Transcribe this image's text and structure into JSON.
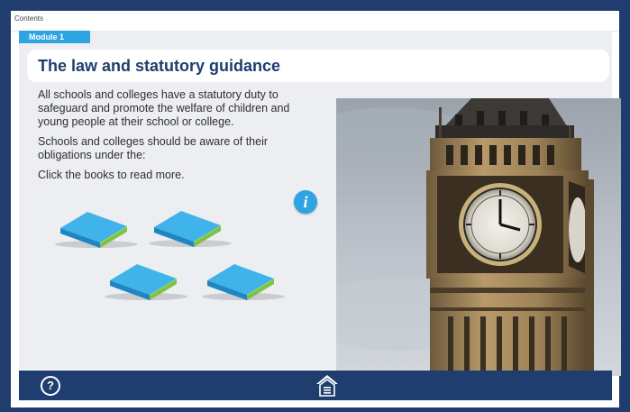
{
  "topbar": {
    "contents_label": "Contents"
  },
  "module": {
    "tab_label": "Module 1"
  },
  "page": {
    "title": "The law and statutory guidance",
    "paragraphs": [
      "All schools and colleges have a statutory duty to safeguard and promote the welfare of children and young people at their school or college.",
      "Schools and colleges should be aware of their obligations under the:",
      "Click the books to read more."
    ]
  },
  "info": {
    "icon": "info-icon",
    "glyph": "i"
  },
  "books": [
    {
      "icon": "book-icon"
    },
    {
      "icon": "book-icon"
    },
    {
      "icon": "book-icon"
    },
    {
      "icon": "book-icon"
    }
  ],
  "image": {
    "subject": "big-ben-clock-tower"
  },
  "footer": {
    "help_glyph": "?",
    "help_icon": "question-icon",
    "home_icon": "home-icon"
  },
  "colors": {
    "navy": "#1f3d6e",
    "accent_blue": "#2ea4e3",
    "book_blue": "#2f9fd6",
    "book_green": "#7fc241",
    "stage_bg": "#eceef1"
  }
}
